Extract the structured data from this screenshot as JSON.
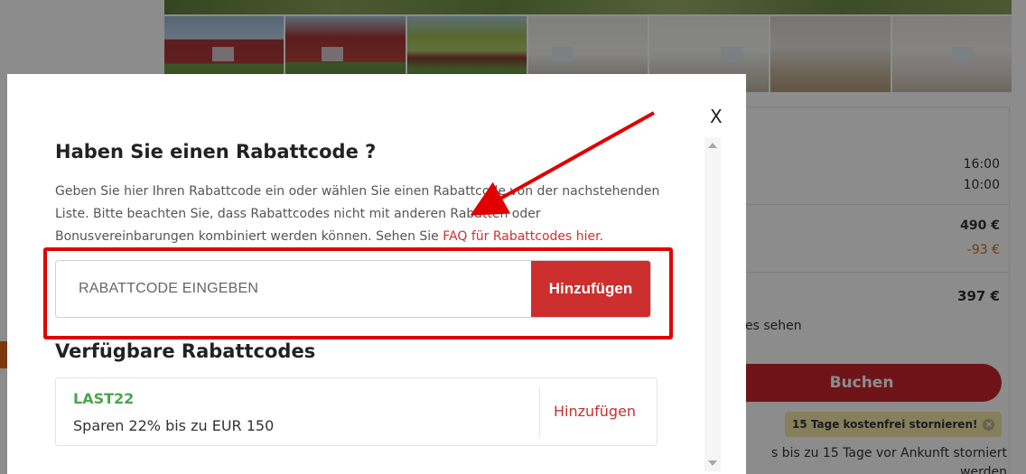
{
  "background": {
    "booking_panel": {
      "checkin_time": "16:00",
      "checkout_time": "10:00",
      "price": "490 €",
      "discount": "-93 €",
      "total": "397 €",
      "see_text": "es sehen",
      "book_button": "Buchen",
      "free_cancel_badge": "15 Tage kostenfrei stornieren!",
      "cancel_text": "s bis zu 15 Tage vor Ankunft storniert werden"
    }
  },
  "modal": {
    "close_label": "X",
    "title": "Haben Sie einen Rabattcode ?",
    "description": "Geben Sie hier Ihren Rabattcode ein oder wählen Sie einen Rabattcode von der nachstehenden Liste. Bitte beachten Sie, dass Rabattcodes nicht mit anderen Rabatten oder Bonusvereinbarungen kombiniert werden können. Sehen Sie ",
    "faq_link": "FAQ für Rabattcodes hier",
    "description_end": ".",
    "code_input_placeholder": "RABATTCODE EINGEBEN",
    "add_button": "Hinzufügen",
    "available_title": "Verfügbare Rabattcodes",
    "codes": [
      {
        "name": "LAST22",
        "description": "Sparen 22% bis zu EUR 150",
        "action": "Hinzufügen"
      }
    ]
  },
  "colors": {
    "brand_red": "#cc2f2e",
    "annotation_red": "#e00000",
    "code_green": "#4aa64a"
  }
}
